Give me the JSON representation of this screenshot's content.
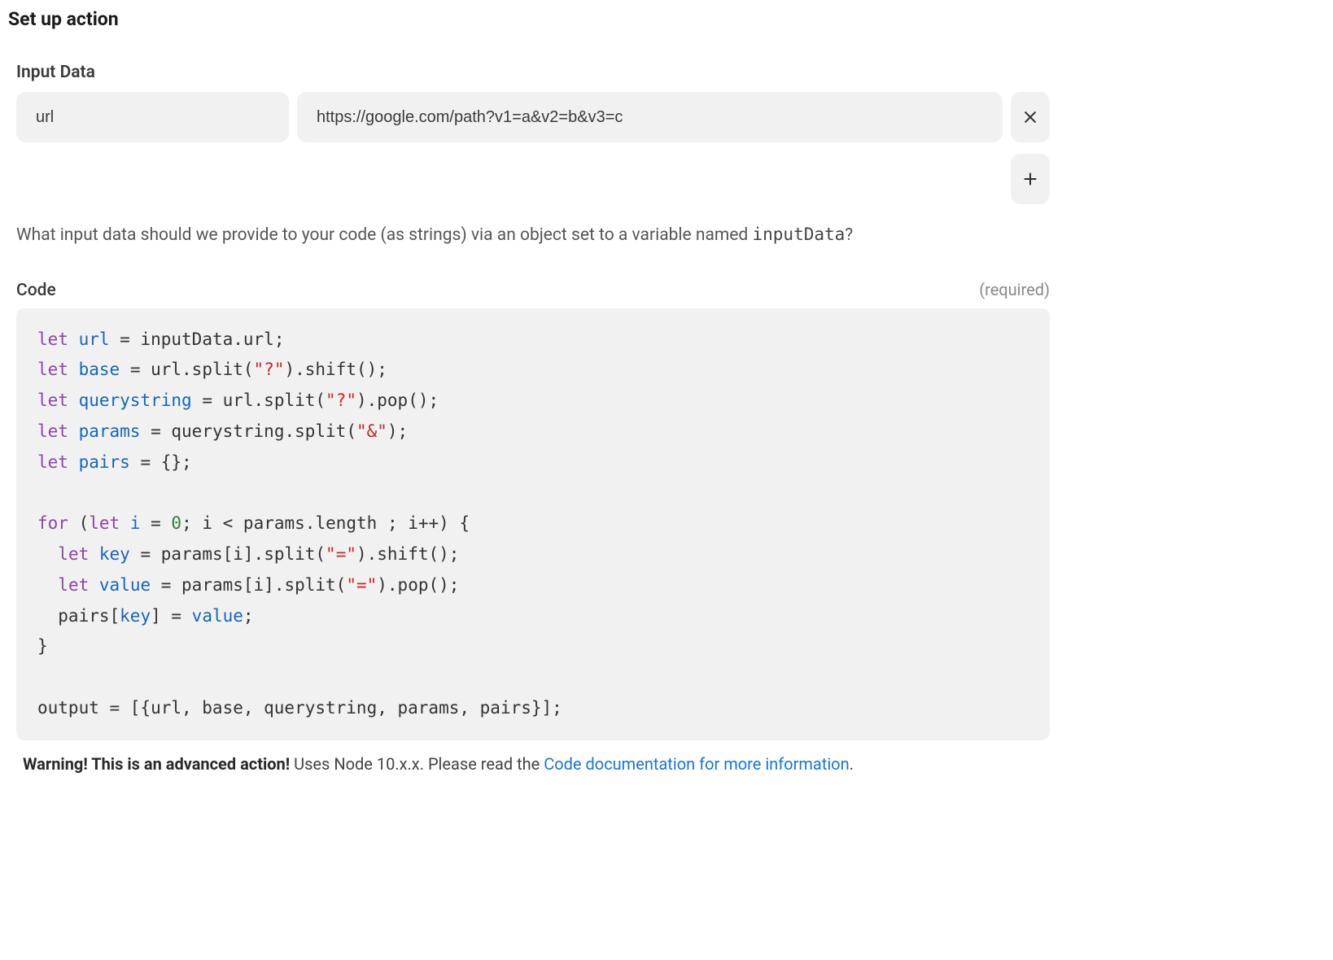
{
  "page_title": "Set up action",
  "input_data": {
    "label": "Input Data",
    "rows": [
      {
        "key": "url",
        "value": "https://google.com/path?v1=a&v2=b&v3=c"
      }
    ],
    "help_prefix": "What input data should we provide to your code (as strings) via an object set to a variable named ",
    "help_var": "inputData",
    "help_suffix": "?"
  },
  "code": {
    "label": "Code",
    "required_label": "(required)",
    "lines": [
      [
        [
          "kw",
          "let"
        ],
        [
          "punc",
          " "
        ],
        [
          "var",
          "url"
        ],
        [
          "punc",
          " = inputData.url;"
        ]
      ],
      [
        [
          "kw",
          "let"
        ],
        [
          "punc",
          " "
        ],
        [
          "var",
          "base"
        ],
        [
          "punc",
          " = url.split("
        ],
        [
          "str",
          "\"?\""
        ],
        [
          "punc",
          ").shift();"
        ]
      ],
      [
        [
          "kw",
          "let"
        ],
        [
          "punc",
          " "
        ],
        [
          "var",
          "querystring"
        ],
        [
          "punc",
          " = url.split("
        ],
        [
          "str",
          "\"?\""
        ],
        [
          "punc",
          ").pop();"
        ]
      ],
      [
        [
          "kw",
          "let"
        ],
        [
          "punc",
          " "
        ],
        [
          "var",
          "params"
        ],
        [
          "punc",
          " = querystring.split("
        ],
        [
          "str",
          "\"&\""
        ],
        [
          "punc",
          ");"
        ]
      ],
      [
        [
          "kw",
          "let"
        ],
        [
          "punc",
          " "
        ],
        [
          "var",
          "pairs"
        ],
        [
          "punc",
          " = {};"
        ]
      ],
      [],
      [
        [
          "kw",
          "for"
        ],
        [
          "punc",
          " ("
        ],
        [
          "kw",
          "let"
        ],
        [
          "punc",
          " "
        ],
        [
          "var",
          "i"
        ],
        [
          "punc",
          " = "
        ],
        [
          "num",
          "0"
        ],
        [
          "punc",
          "; i < params.length ; i++) {"
        ]
      ],
      [
        [
          "punc",
          "  "
        ],
        [
          "kw",
          "let"
        ],
        [
          "punc",
          " "
        ],
        [
          "var",
          "key"
        ],
        [
          "punc",
          " = params[i].split("
        ],
        [
          "str",
          "\"=\""
        ],
        [
          "punc",
          ").shift();"
        ]
      ],
      [
        [
          "punc",
          "  "
        ],
        [
          "kw",
          "let"
        ],
        [
          "punc",
          " "
        ],
        [
          "var",
          "value"
        ],
        [
          "punc",
          " = params[i].split("
        ],
        [
          "str",
          "\"=\""
        ],
        [
          "punc",
          ").pop();"
        ]
      ],
      [
        [
          "punc",
          "  pairs["
        ],
        [
          "var",
          "key"
        ],
        [
          "punc",
          "] = "
        ],
        [
          "var",
          "value"
        ],
        [
          "punc",
          ";"
        ]
      ],
      [
        [
          "punc",
          "}"
        ]
      ],
      [],
      [
        [
          "punc",
          "output = [{url, base, querystring, params, pairs}];"
        ]
      ]
    ]
  },
  "warning": {
    "bold": "Warning! This is an advanced action!",
    "text": " Uses Node 10.x.x. Please read the ",
    "link": "Code documentation for more information",
    "suffix": "."
  }
}
